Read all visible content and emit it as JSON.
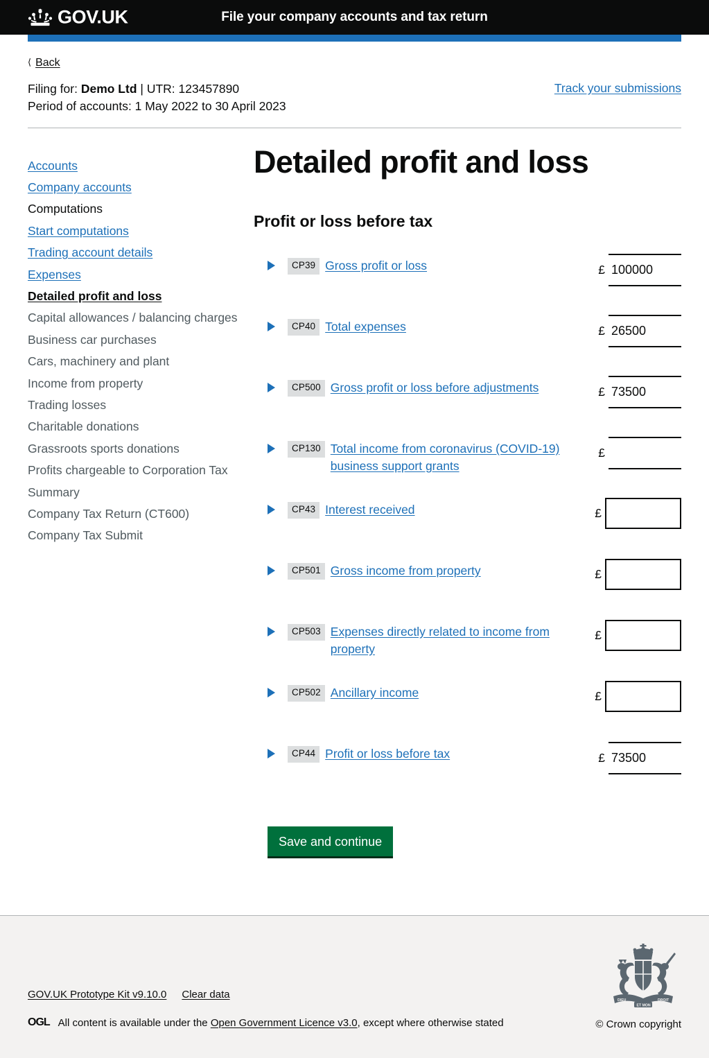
{
  "header": {
    "brand": "GOV.UK",
    "brand_icon": "crown-icon",
    "service_name": "File your company accounts and tax return"
  },
  "back": {
    "icon": "chevron-left-icon",
    "label": "Back"
  },
  "filing": {
    "line1_prefix": "Filing for: ",
    "company": "Demo Ltd",
    "line1_separator": " | ",
    "utr_label": "UTR: ",
    "utr": "123457890",
    "line2": "Period of accounts: 1 May 2022 to 30 April 2023",
    "track_link": "Track your submissions"
  },
  "sidebar": {
    "items": [
      {
        "label": "Accounts",
        "state": "link"
      },
      {
        "label": "Company accounts",
        "state": "link"
      },
      {
        "label": "Computations",
        "state": "plain"
      },
      {
        "label": "Start computations",
        "state": "link"
      },
      {
        "label": "Trading account details",
        "state": "link"
      },
      {
        "label": "Expenses",
        "state": "link"
      },
      {
        "label": "Detailed profit and loss",
        "state": "current"
      },
      {
        "label": "Capital allowances / balancing charges",
        "state": "muted"
      },
      {
        "label": "Business car purchases",
        "state": "muted"
      },
      {
        "label": "Cars, machinery and plant",
        "state": "muted"
      },
      {
        "label": "Income from property",
        "state": "muted"
      },
      {
        "label": "Trading losses",
        "state": "muted"
      },
      {
        "label": "Charitable donations",
        "state": "muted"
      },
      {
        "label": "Grassroots sports donations",
        "state": "muted"
      },
      {
        "label": "Profits chargeable to Corporation Tax",
        "state": "muted"
      },
      {
        "label": "Summary",
        "state": "muted"
      },
      {
        "label": "Company Tax Return (CT600)",
        "state": "muted"
      },
      {
        "label": "Company Tax Submit",
        "state": "muted"
      }
    ]
  },
  "main": {
    "title": "Detailed profit and loss",
    "section_heading": "Profit or loss before tax",
    "currency_symbol": "£",
    "rows": [
      {
        "code": "CP39",
        "label": "Gross profit or loss",
        "value": "100000",
        "type": "readonly"
      },
      {
        "code": "CP40",
        "label": "Total expenses",
        "value": "26500",
        "type": "readonly"
      },
      {
        "code": "CP500",
        "label": "Gross profit or loss before adjustments",
        "value": "73500",
        "type": "readonly"
      },
      {
        "code": "CP130",
        "label": "Total income from coronavirus (COVID-19) business support grants",
        "value": "",
        "type": "readonly"
      },
      {
        "code": "CP43",
        "label": "Interest received",
        "value": "",
        "type": "input"
      },
      {
        "code": "CP501",
        "label": "Gross income from property",
        "value": "",
        "type": "input"
      },
      {
        "code": "CP503",
        "label": "Expenses directly related to income from property",
        "value": "",
        "type": "input"
      },
      {
        "code": "CP502",
        "label": "Ancillary income",
        "value": "",
        "type": "input"
      },
      {
        "code": "CP44",
        "label": "Profit or loss before tax",
        "value": "73500",
        "type": "readonly"
      }
    ],
    "save_button": "Save and continue"
  },
  "footer": {
    "prototype_kit": "GOV.UK Prototype Kit v9.10.0",
    "clear_data": "Clear data",
    "ogl_logo": "OGL",
    "licence_prefix": "All content is available under the ",
    "licence_link": "Open Government Licence v3.0",
    "licence_suffix": ", except where otherwise stated",
    "copyright": "© Crown copyright",
    "crest_icon": "royal-coat-of-arms-icon"
  },
  "colors": {
    "black": "#0b0c0c",
    "link_blue": "#1d70b8",
    "accent_blue": "#1d70b8",
    "green_button": "#00703c",
    "grey_chip": "#dcdedf",
    "footer_bg": "#f3f2f1",
    "muted_text": "#505a5f"
  }
}
